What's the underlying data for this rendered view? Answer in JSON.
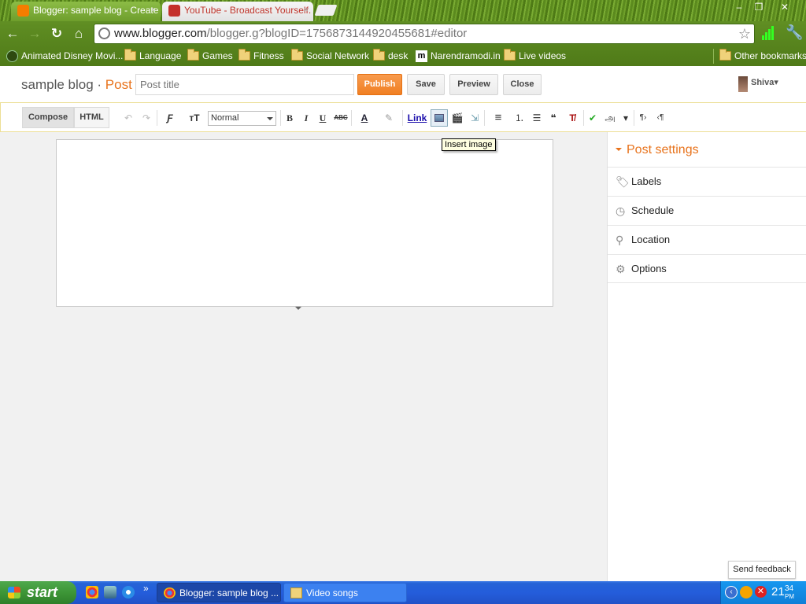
{
  "browser": {
    "tabs": [
      {
        "title": "Blogger: sample blog - Create",
        "close": "×",
        "active": true
      },
      {
        "title": "YouTube - Broadcast Yourself.",
        "close": "×",
        "active": false
      }
    ],
    "window_controls": {
      "minimize": "–",
      "maximize": "❐",
      "close": "✕"
    },
    "nav": {
      "back": "←",
      "forward": "→",
      "reload": "↻",
      "home": "⌂"
    },
    "url": {
      "host": "www.blogger.com",
      "path": "/blogger.g?blogID=1756873144920455681#editor"
    },
    "bookmark_star": "☆",
    "wrench": "🔧",
    "bookmarks": [
      {
        "label": "Animated Disney Movi...",
        "icon": "globe-icon"
      },
      {
        "label": "Language",
        "icon": "folder-icon"
      },
      {
        "label": "Games",
        "icon": "folder-icon"
      },
      {
        "label": "Fitness",
        "icon": "folder-icon"
      },
      {
        "label": "Social Network",
        "icon": "folder-icon"
      },
      {
        "label": "desk",
        "icon": "folder-icon"
      },
      {
        "label": "Narendramodi.in",
        "icon": "site-icon",
        "badge": "m"
      },
      {
        "label": "Live videos",
        "icon": "folder-icon"
      }
    ],
    "other_bookmarks": "Other bookmarks"
  },
  "blogger": {
    "blog_name": "sample blog",
    "separator": " · ",
    "section": "Post",
    "post_title_placeholder": "Post title",
    "buttons": {
      "publish": "Publish",
      "save": "Save",
      "preview": "Preview",
      "close": "Close"
    },
    "user": "Shiva",
    "user_caret": "▾",
    "accent_color": "#e8731c"
  },
  "editor_toolbar": {
    "modes": {
      "compose": "Compose",
      "html": "HTML"
    },
    "undo": "↶",
    "redo": "↷",
    "font": "Ƒ",
    "font_size": "тT",
    "format_select": "Normal",
    "bold": "B",
    "italic": "I",
    "underline": "U",
    "strike": "ABC",
    "text_color": "A",
    "highlight": "✎",
    "link": "Link",
    "video": "🎬",
    "jump_break": "⇲",
    "align": "≡",
    "numbered_list": "⒈",
    "bullet_list": "☰",
    "quote": "❝",
    "clear_format": "T̸",
    "spellcheck": "✔",
    "input_tools": "அ",
    "more": "▾",
    "ltr": "¶›",
    "rtl": "‹¶"
  },
  "tooltip": "Insert image",
  "post_settings": {
    "title": "Post settings",
    "items": [
      {
        "label": "Labels",
        "icon": "tag-icon",
        "glyph": "🏷"
      },
      {
        "label": "Schedule",
        "icon": "clock-icon",
        "glyph": "◷"
      },
      {
        "label": "Location",
        "icon": "pin-icon",
        "glyph": "⚲"
      },
      {
        "label": "Options",
        "icon": "gear-icon",
        "glyph": "⚙"
      }
    ]
  },
  "send_feedback": "Send feedback",
  "taskbar": {
    "start": "start",
    "quick_launch_more": "»",
    "tasks": [
      {
        "label": "Blogger: sample blog ...",
        "active": true
      },
      {
        "label": "Video songs",
        "active": false
      }
    ],
    "clock": {
      "hour": "21",
      "minute": "34",
      "ampm": "PM"
    }
  }
}
